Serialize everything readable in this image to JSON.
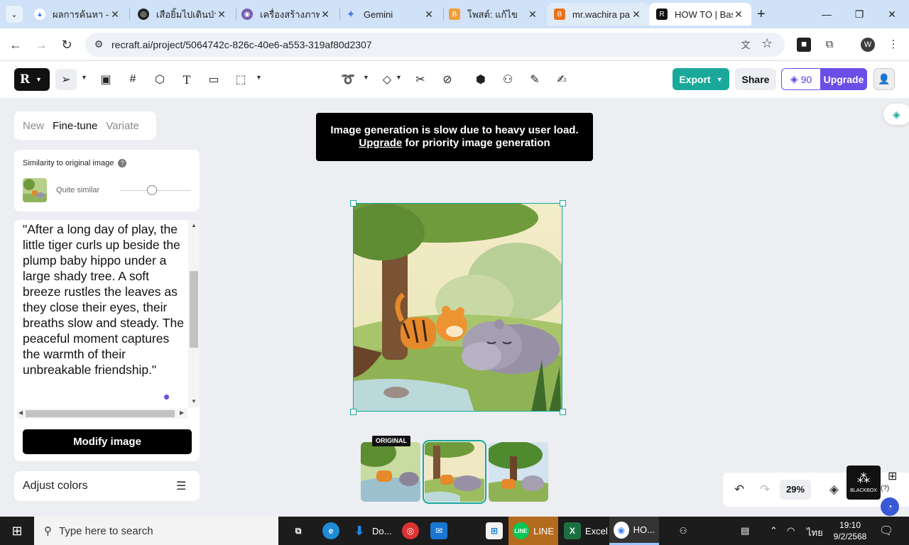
{
  "browser": {
    "tabs": [
      {
        "label": "ผลการค้นหา - G",
        "color": "#4285f4",
        "glyph": "▲"
      },
      {
        "label": "เสือยิ้มไปเดินป่า",
        "color": "#222222",
        "glyph": "◎"
      },
      {
        "label": "เครื่องสร้างภาพ",
        "color": "#7a5bb0",
        "glyph": "◉"
      },
      {
        "label": "Gemini",
        "color": "#4b7bec",
        "glyph": "✦"
      },
      {
        "label": "โพสต์: แก้ไข",
        "color": "#f29d38",
        "glyph": "B"
      },
      {
        "label": "mr.wachira pa",
        "color": "#e8711c",
        "glyph": "B"
      },
      {
        "label": "HOW TO | Bas",
        "color": "#111111",
        "glyph": "R"
      }
    ],
    "url": "recraft.ai/project/5064742c-826c-40e6-a553-319af80d2307",
    "profile_initial": "W"
  },
  "header": {
    "export_label": "Export",
    "share_label": "Share",
    "credits": "90",
    "upgrade_label": "Upgrade"
  },
  "left_panel": {
    "tabs": [
      "New",
      "Fine-tune",
      "Variate"
    ],
    "active_tab": "Fine-tune",
    "similarity_title": "Similarity to original image",
    "similarity_value": "Quite similar",
    "similarity_level": 0.45,
    "prompt": "\"After a long day of play, the little tiger curls up beside the plump baby hippo under a large shady tree. A soft breeze rustles the leaves as they close their eyes, their breaths slow and steady. The peaceful moment captures the warmth of their unbreakable friendship.\"",
    "modify_label": "Modify image",
    "adjust_label": "Adjust colors"
  },
  "canvas": {
    "toast_line1": "Image generation is slow due to heavy user load.",
    "toast_link": "Upgrade",
    "toast_line2_rest": " for priority image generation",
    "original_badge": "ORIGINAL",
    "zoom": "29%",
    "blackbox_label": "BLACKBOX"
  },
  "taskbar": {
    "search_placeholder": "Type here to search",
    "apps": [
      {
        "label": "Do...",
        "color": "#1e88e5"
      },
      {
        "label": "LINE",
        "color": "#06c755"
      },
      {
        "label": "Excel",
        "color": "#1d6f42"
      },
      {
        "label": "HO...",
        "color": "#4285f4"
      }
    ],
    "lang": "ไทย",
    "time": "19:10",
    "date": "9/2/2568"
  }
}
